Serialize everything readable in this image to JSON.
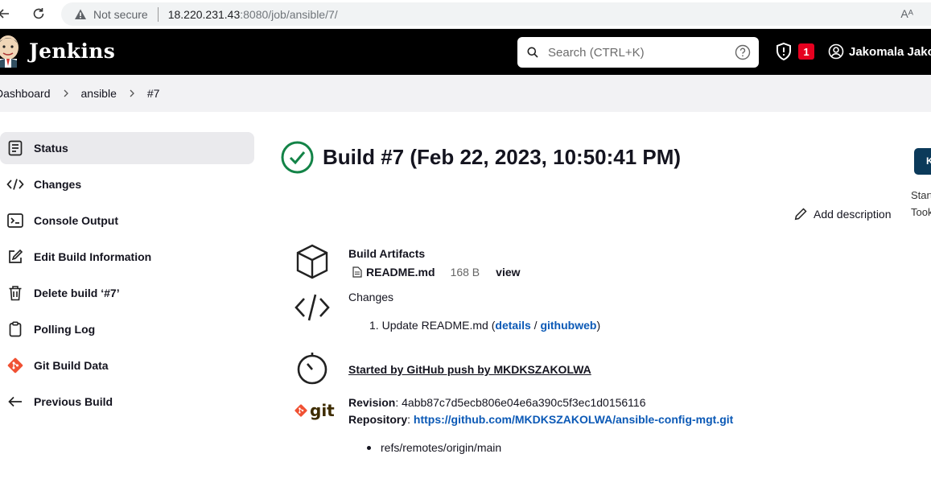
{
  "browser": {
    "security_label": "Not secure",
    "url_host": "18.220.231.43",
    "url_rest": ":8080/job/ansible/7/",
    "reader_label": "Aᴬ"
  },
  "header": {
    "brand": "Jenkins",
    "search_placeholder": "Search (CTRL+K)",
    "security_badge": "1",
    "user_name": "Jakomala Jako"
  },
  "breadcrumbs": [
    "Dashboard",
    "ansible",
    "#7"
  ],
  "sidebar": {
    "items": [
      {
        "label": "Status",
        "icon": "status-icon"
      },
      {
        "label": "Changes",
        "icon": "code-icon"
      },
      {
        "label": "Console Output",
        "icon": "terminal-icon"
      },
      {
        "label": "Edit Build Information",
        "icon": "edit-icon"
      },
      {
        "label": "Delete build ‘#7’",
        "icon": "trash-icon"
      },
      {
        "label": "Polling Log",
        "icon": "clipboard-icon"
      },
      {
        "label": "Git Build Data",
        "icon": "git-icon"
      },
      {
        "label": "Previous Build",
        "icon": "arrow-left-icon"
      }
    ]
  },
  "main": {
    "build_title": "Build #7 (Feb 22, 2023, 10:50:41 PM)",
    "right_button_label": "K",
    "right_text_1": "Start",
    "right_text_2": "Took",
    "add_description": "Add description",
    "artifacts": {
      "heading": "Build Artifacts",
      "file_name": "README.md",
      "file_size": "168 B",
      "view_label": "view"
    },
    "changes": {
      "heading": "Changes",
      "item_number": "1.",
      "item_text": "Update README.md (",
      "details_label": "details",
      "slash": " / ",
      "githubweb_label": "githubweb",
      "close_paren": ")"
    },
    "started_by": "Started by GitHub push by MKDKSZAKOLWA",
    "git": {
      "logo_text": "git",
      "revision_label": "Revision",
      "revision_value": ": 4abb87c7d5ecb806e04e6a390c5f3ec1d0156116",
      "repository_label": "Repository",
      "repository_sep": ": ",
      "repository_url": "https://github.com/MKDKSZAKOLWA/ansible-config-mgt.git",
      "branch": "refs/remotes/origin/main"
    }
  },
  "colors": {
    "header_bg": "#000000",
    "link": "#0b59b6",
    "success": "#138347",
    "badge": "#e6001f",
    "git": "#f05133"
  }
}
